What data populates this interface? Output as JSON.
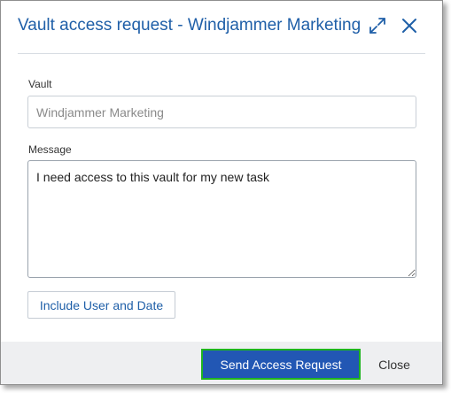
{
  "dialog": {
    "title": "Vault access request - Windjammer Marketing",
    "expand_icon": "expand-icon",
    "close_icon": "close-icon"
  },
  "form": {
    "vault_label": "Vault",
    "vault_value": "Windjammer Marketing",
    "message_label": "Message",
    "message_value": "I need access to this vault for my new task",
    "include_button": "Include User and Date"
  },
  "footer": {
    "send_button": "Send Access Request",
    "close_button": "Close"
  },
  "colors": {
    "accent": "#1f5fa8",
    "primary_button": "#2257b4",
    "focus_outline": "#1fb51f",
    "footer_bg": "#eeeff1"
  }
}
